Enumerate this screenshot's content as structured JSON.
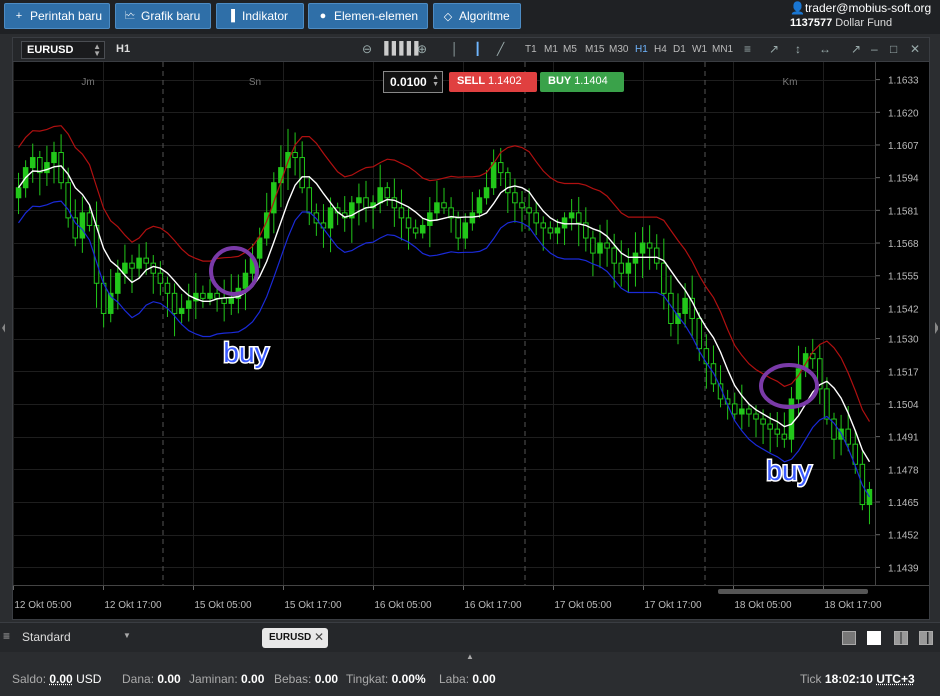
{
  "toolbar": {
    "new_order": "Perintah baru",
    "new_chart": "Grafik baru",
    "indicator": "Indikator",
    "elements": "Elemen-elemen",
    "algorithm": "Algoritme"
  },
  "account": {
    "user": "trader@mobius-soft.org",
    "number": "1137577",
    "fund": "Dollar Fund"
  },
  "chart": {
    "symbol": "EURUSD",
    "timeframe": "H1",
    "timeframes": [
      "T1",
      "M1",
      "M5",
      "M15",
      "M30",
      "H1",
      "H4",
      "D1",
      "W1",
      "MN1"
    ],
    "active_timeframe": "H1",
    "lot": "0.0100",
    "sell_label": "SELL",
    "sell_price": "1.1402",
    "buy_label": "BUY",
    "buy_price": "1.1404",
    "day_labels": [
      "Jm",
      "Sn",
      "Km"
    ],
    "annotations": [
      "buy",
      "buy"
    ]
  },
  "chart_data": {
    "type": "candlestick",
    "price_ticks": [
      "1.1633",
      "1.1620",
      "1.1607",
      "1.1594",
      "1.1581",
      "1.1568",
      "1.1555",
      "1.1542",
      "1.1530",
      "1.1517",
      "1.1504",
      "1.1491",
      "1.1478",
      "1.1465",
      "1.1452",
      "1.1439"
    ],
    "time_ticks": [
      "12 Okt 05:00",
      "12 Okt 17:00",
      "15 Okt 05:00",
      "15 Okt 17:00",
      "16 Okt 05:00",
      "16 Okt 17:00",
      "17 Okt 05:00",
      "17 Okt 17:00",
      "18 Okt 05:00",
      "18 Okt 17:00"
    ],
    "ylim": [
      1.1432,
      1.164
    ],
    "closes": [
      1.159,
      1.1598,
      1.1602,
      1.1596,
      1.16,
      1.1604,
      1.1592,
      1.1578,
      1.157,
      1.158,
      1.1575,
      1.1552,
      1.154,
      1.1548,
      1.1556,
      1.156,
      1.1558,
      1.1562,
      1.156,
      1.1556,
      1.1552,
      1.1548,
      1.154,
      1.1542,
      1.1545,
      1.1548,
      1.1546,
      1.1548,
      1.1546,
      1.1544,
      1.1546,
      1.155,
      1.1556,
      1.1562,
      1.157,
      1.158,
      1.1592,
      1.1598,
      1.1604,
      1.1602,
      1.159,
      1.158,
      1.1576,
      1.1574,
      1.1582,
      1.158,
      1.1578,
      1.1584,
      1.1586,
      1.1582,
      1.1584,
      1.159,
      1.1586,
      1.1582,
      1.1578,
      1.1574,
      1.1572,
      1.1575,
      1.158,
      1.1584,
      1.1582,
      1.1578,
      1.157,
      1.1576,
      1.158,
      1.1586,
      1.159,
      1.16,
      1.1596,
      1.1588,
      1.1584,
      1.1582,
      1.158,
      1.1576,
      1.1574,
      1.1572,
      1.1574,
      1.1578,
      1.158,
      1.1576,
      1.157,
      1.1564,
      1.1568,
      1.1566,
      1.156,
      1.1556,
      1.156,
      1.1564,
      1.1568,
      1.1566,
      1.156,
      1.1548,
      1.1536,
      1.154,
      1.1546,
      1.1538,
      1.1526,
      1.152,
      1.1512,
      1.1506,
      1.1504,
      1.15,
      1.1502,
      1.15,
      1.1498,
      1.1496,
      1.1494,
      1.1492,
      1.149,
      1.1506,
      1.1518,
      1.1524,
      1.1522,
      1.151,
      1.1498,
      1.149,
      1.1494,
      1.1488,
      1.148,
      1.1464,
      1.147
    ]
  },
  "bottom": {
    "layout_name": "Standard",
    "tab_label": "EURUSD"
  },
  "status": {
    "saldo_label": "Saldo:",
    "saldo_value": "0.00",
    "saldo_cur": "USD",
    "dana_label": "Dana:",
    "dana_value": "0.00",
    "jaminan_label": "Jaminan:",
    "jaminan_value": "0.00",
    "bebas_label": "Bebas:",
    "bebas_value": "0.00",
    "tingkat_label": "Tingkat:",
    "tingkat_value": "0.00%",
    "laba_label": "Laba:",
    "laba_value": "0.00",
    "tick_label": "Tick",
    "time": "18:02:10",
    "tz": "UTC+3"
  },
  "colors": {
    "bull": "#22c71a",
    "bear": "#22c71a",
    "upper_band": "#b01010",
    "lower_band": "#1a2ad8",
    "middle": "#ffffff",
    "circle": "#7a3aa8",
    "buy_text": "#3a5aff"
  }
}
